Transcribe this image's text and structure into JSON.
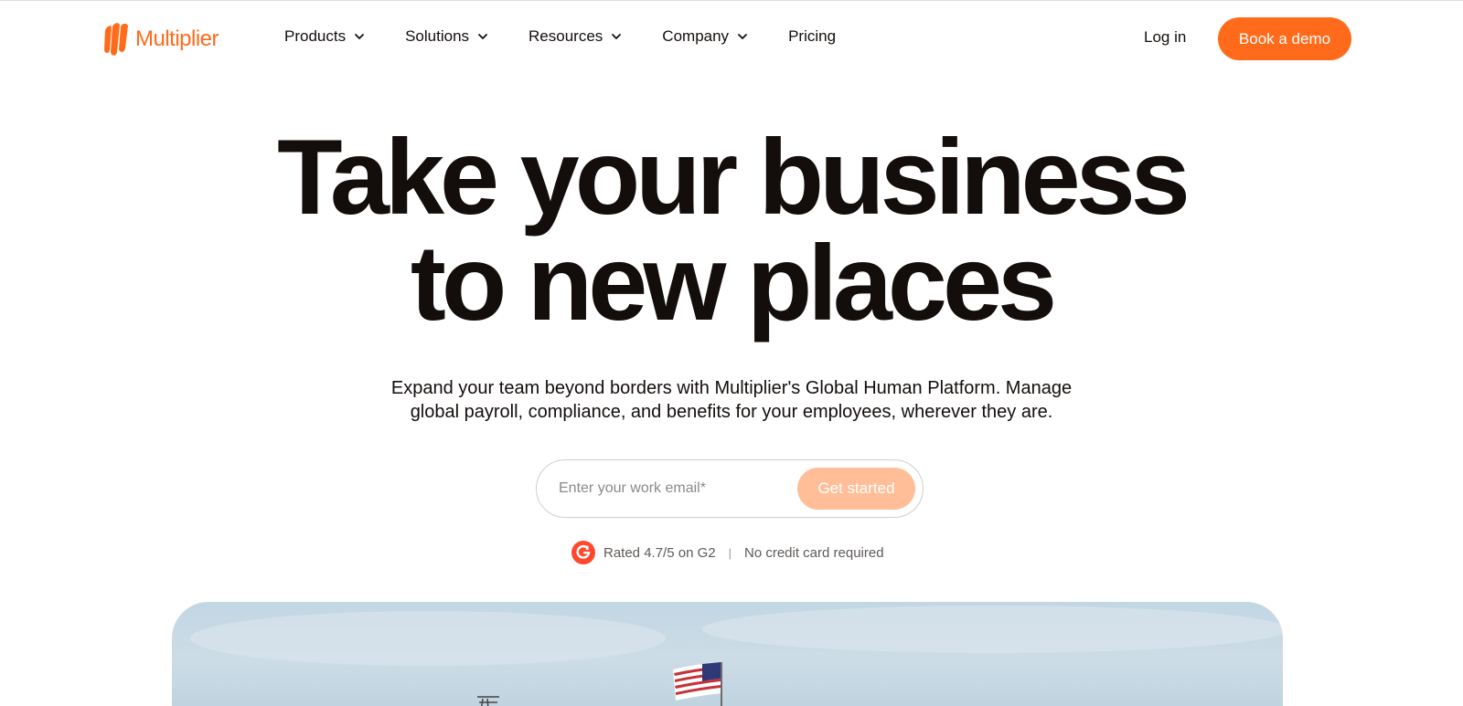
{
  "brand": {
    "name": "Multiplier",
    "color": "#ff6b1a"
  },
  "nav": {
    "items": [
      {
        "label": "Products",
        "has_dropdown": true
      },
      {
        "label": "Solutions",
        "has_dropdown": true
      },
      {
        "label": "Resources",
        "has_dropdown": true
      },
      {
        "label": "Company",
        "has_dropdown": true
      },
      {
        "label": "Pricing",
        "has_dropdown": false
      }
    ],
    "login_label": "Log in",
    "demo_label": "Book a demo"
  },
  "hero": {
    "headline_line1": "Take your business",
    "headline_line2": "to new places",
    "subhead_line1": "Expand your team beyond borders with Multiplier's Global Human Platform. Manage",
    "subhead_line2": "global payroll, compliance, and benefits for your employees, wherever they are."
  },
  "signup": {
    "email_placeholder": "Enter your work email*",
    "email_value": "",
    "submit_label": "Get started",
    "submit_color": "#ffbe98"
  },
  "rating": {
    "icon": "g2-icon",
    "icon_color": "#ff492c",
    "text": "Rated 4.7/5 on G2",
    "separator": "|",
    "note": "No credit card required"
  },
  "colors": {
    "accent": "#ff6b1a",
    "text": "#130e0c",
    "muted": "#5e5a57"
  }
}
